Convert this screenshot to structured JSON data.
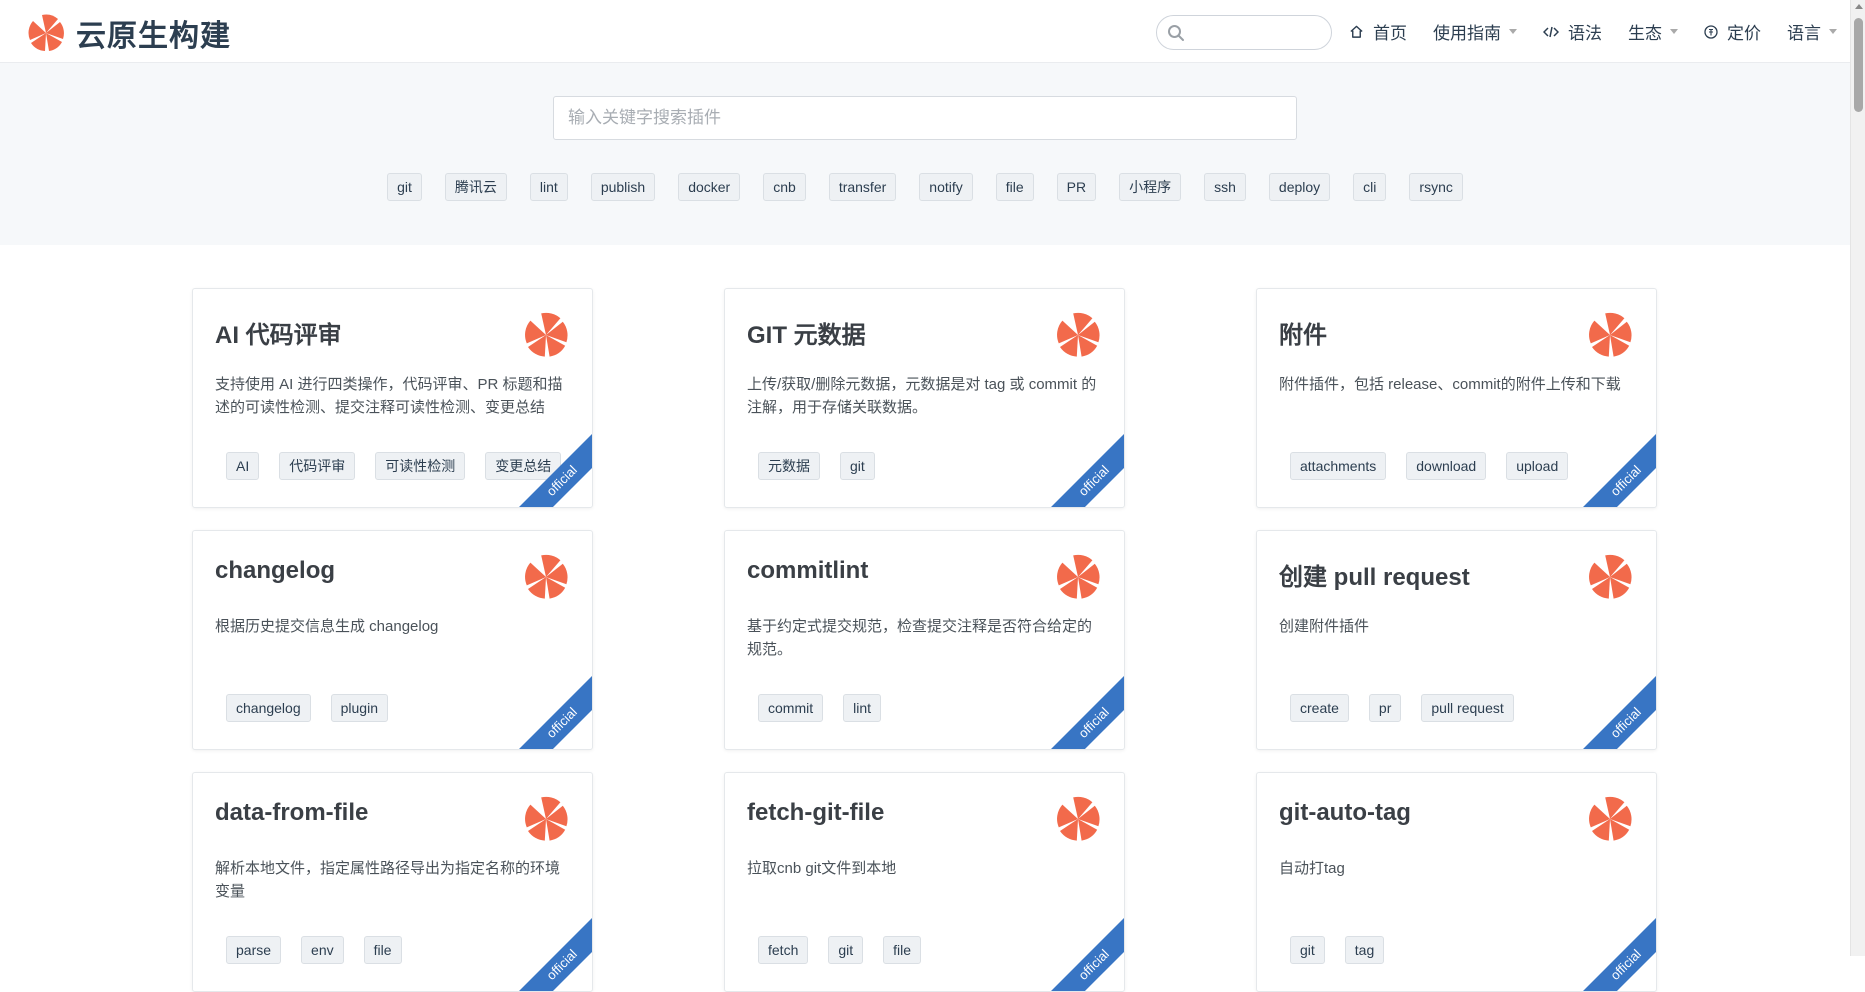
{
  "brand": {
    "title": "云原生构建",
    "accent": "#f26a4b"
  },
  "nav": {
    "search_value": "",
    "items": [
      {
        "label": "首页",
        "icon": "home-icon",
        "dropdown": false
      },
      {
        "label": "使用指南",
        "icon": "",
        "dropdown": true
      },
      {
        "label": "语法",
        "icon": "code-icon",
        "dropdown": false
      },
      {
        "label": "生态",
        "icon": "",
        "dropdown": true
      },
      {
        "label": "定价",
        "icon": "coin-icon",
        "dropdown": false
      },
      {
        "label": "语言",
        "icon": "",
        "dropdown": true
      }
    ]
  },
  "plugin_search": {
    "placeholder": "输入关键字搜索插件",
    "value": ""
  },
  "quick_tags": [
    "git",
    "腾讯云",
    "lint",
    "publish",
    "docker",
    "cnb",
    "transfer",
    "notify",
    "file",
    "PR",
    "小程序",
    "ssh",
    "deploy",
    "cli",
    "rsync"
  ],
  "cards": [
    {
      "title": "AI 代码评审",
      "desc": "支持使用 AI 进行四类操作，代码评审、PR 标题和描述的可读性检测、提交注释可读性检测、变更总结",
      "tags": [
        "AI",
        "代码评审",
        "可读性检测",
        "变更总结"
      ],
      "badge": "official"
    },
    {
      "title": "GIT 元数据",
      "desc": "上传/获取/删除元数据，元数据是对 tag 或 commit 的注解，用于存储关联数据。",
      "tags": [
        "元数据",
        "git"
      ],
      "badge": "official"
    },
    {
      "title": "附件",
      "desc": "附件插件，包括 release、commit的附件上传和下载",
      "tags": [
        "attachments",
        "download",
        "upload"
      ],
      "badge": "official"
    },
    {
      "title": "changelog",
      "desc": "根据历史提交信息生成 changelog",
      "tags": [
        "changelog",
        "plugin"
      ],
      "badge": "official"
    },
    {
      "title": "commitlint",
      "desc": "基于约定式提交规范，检查提交注释是否符合给定的规范。",
      "tags": [
        "commit",
        "lint"
      ],
      "badge": "official"
    },
    {
      "title": "创建 pull request",
      "desc": "创建附件插件",
      "tags": [
        "create",
        "pr",
        "pull request"
      ],
      "badge": "official"
    },
    {
      "title": "data-from-file",
      "desc": "解析本地文件，指定属性路径导出为指定名称的环境变量",
      "tags": [
        "parse",
        "env",
        "file"
      ],
      "badge": "official"
    },
    {
      "title": "fetch-git-file",
      "desc": "拉取cnb git文件到本地",
      "tags": [
        "fetch",
        "git",
        "file"
      ],
      "badge": "official"
    },
    {
      "title": "git-auto-tag",
      "desc": "自动打tag",
      "tags": [
        "git",
        "tag"
      ],
      "badge": "official"
    }
  ]
}
